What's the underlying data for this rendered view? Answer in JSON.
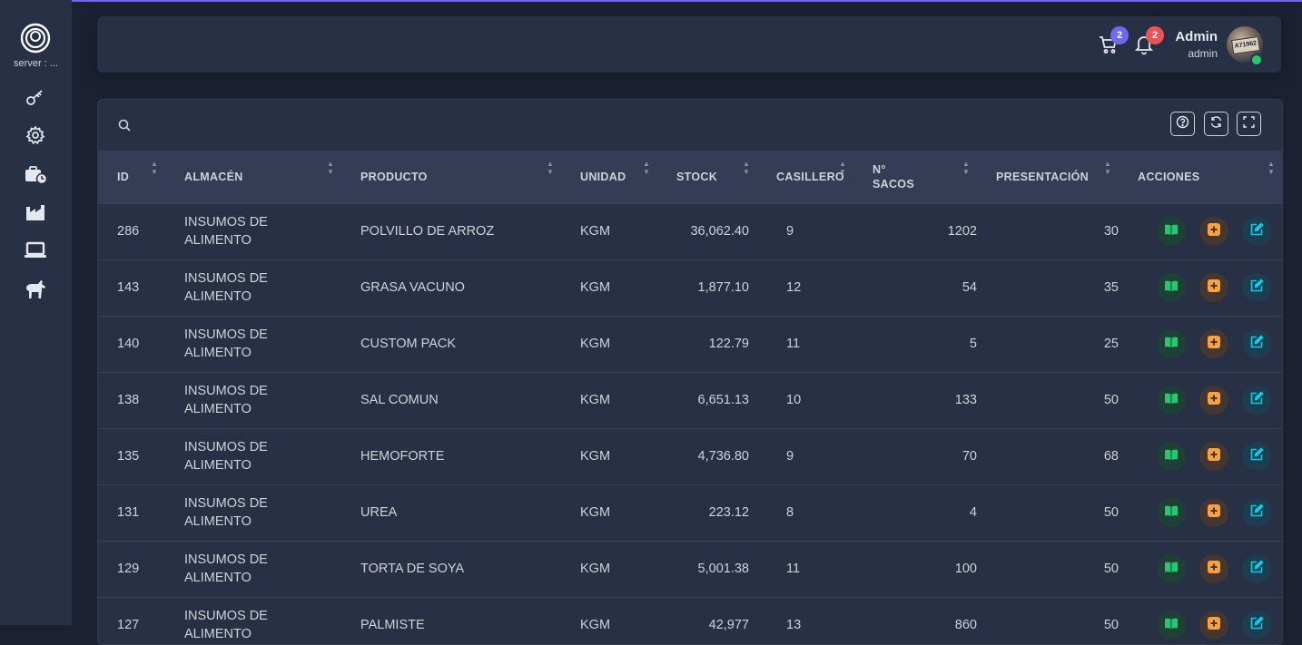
{
  "sidebar": {
    "server_label": "server : ...",
    "items": [
      {
        "icon": "key-icon"
      },
      {
        "icon": "gear-icon"
      },
      {
        "icon": "briefcase-clock-icon"
      },
      {
        "icon": "factory-icon"
      },
      {
        "icon": "laptop-icon"
      },
      {
        "icon": "horse-icon"
      }
    ]
  },
  "header": {
    "cart_count": "2",
    "notification_count": "2",
    "user_name": "Admin",
    "user_role": "admin",
    "avatar_text": "A71962"
  },
  "table": {
    "search_placeholder": "",
    "columns": [
      "ID",
      "ALMACÉN",
      "PRODUCTO",
      "UNIDAD",
      "STOCK",
      "CASILLERO",
      "N° SACOS",
      "PRESENTACIÓN",
      "ACCIONES"
    ],
    "rows": [
      {
        "id": "286",
        "almacen": "INSUMOS DE ALIMENTO",
        "producto": "POLVILLO DE ARROZ",
        "unidad": "KGM",
        "stock": "36,062.40",
        "casillero": "9",
        "sacos": "1202",
        "presentacion": "30"
      },
      {
        "id": "143",
        "almacen": "INSUMOS DE ALIMENTO",
        "producto": "GRASA VACUNO",
        "unidad": "KGM",
        "stock": "1,877.10",
        "casillero": "12",
        "sacos": "54",
        "presentacion": "35"
      },
      {
        "id": "140",
        "almacen": "INSUMOS DE ALIMENTO",
        "producto": "CUSTOM PACK",
        "unidad": "KGM",
        "stock": "122.79",
        "casillero": "11",
        "sacos": "5",
        "presentacion": "25"
      },
      {
        "id": "138",
        "almacen": "INSUMOS DE ALIMENTO",
        "producto": "SAL COMUN",
        "unidad": "KGM",
        "stock": "6,651.13",
        "casillero": "10",
        "sacos": "133",
        "presentacion": "50"
      },
      {
        "id": "135",
        "almacen": "INSUMOS DE ALIMENTO",
        "producto": "HEMOFORTE",
        "unidad": "KGM",
        "stock": "4,736.80",
        "casillero": "9",
        "sacos": "70",
        "presentacion": "68"
      },
      {
        "id": "131",
        "almacen": "INSUMOS DE ALIMENTO",
        "producto": "UREA",
        "unidad": "KGM",
        "stock": "223.12",
        "casillero": "8",
        "sacos": "4",
        "presentacion": "50"
      },
      {
        "id": "129",
        "almacen": "INSUMOS DE ALIMENTO",
        "producto": "TORTA DE SOYA",
        "unidad": "KGM",
        "stock": "5,001.38",
        "casillero": "11",
        "sacos": "100",
        "presentacion": "50"
      },
      {
        "id": "127",
        "almacen": "INSUMOS DE ALIMENTO",
        "producto": "PALMISTE",
        "unidad": "KGM",
        "stock": "42,977",
        "casillero": "13",
        "sacos": "860",
        "presentacion": "50"
      }
    ]
  },
  "colors": {
    "accent": "#7367f0",
    "danger": "#ea5455",
    "success": "#28c76f",
    "warning": "#ff9f43",
    "info": "#00cfe8"
  }
}
